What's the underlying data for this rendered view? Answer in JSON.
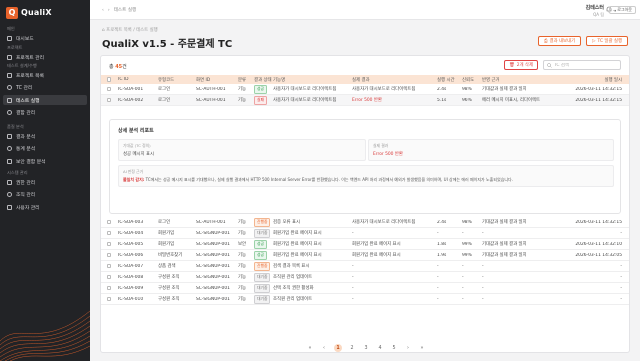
{
  "app": {
    "name": "QualiX",
    "logo_letter": "Q"
  },
  "sidebar": {
    "sections": [
      {
        "title": "메인",
        "items": [
          {
            "label": "대시보드",
            "icon": "grid-icon"
          }
        ]
      },
      {
        "title": "프로젝트",
        "items": [
          {
            "label": "프로젝트 관리",
            "icon": "folder-icon"
          }
        ]
      },
      {
        "title": "테스트 설계/수행",
        "items": [
          {
            "label": "프로젝트 목록",
            "icon": "list-icon"
          },
          {
            "label": "TC 관리",
            "icon": "doc-icon"
          },
          {
            "label": "테스트 실행",
            "icon": "play-icon",
            "active": true
          },
          {
            "label": "결함 관리",
            "icon": "bug-icon"
          }
        ]
      },
      {
        "title": "품질 분석",
        "items": [
          {
            "label": "결과 분석",
            "icon": "chart-icon"
          },
          {
            "label": "통계 분석",
            "icon": "stats-icon"
          },
          {
            "label": "보안 결함 분석",
            "icon": "shield-icon"
          }
        ]
      },
      {
        "title": "시스템 관리",
        "items": [
          {
            "label": "권한 관리",
            "icon": "key-icon"
          },
          {
            "label": "조직 관리",
            "icon": "org-icon"
          },
          {
            "label": "사용자 관리",
            "icon": "user-icon"
          }
        ]
      }
    ]
  },
  "topbar": {
    "breadcrumb": "테스트 실행",
    "user_name": "김테스터",
    "user_role": "QA 팀",
    "logout": "로그아웃"
  },
  "page": {
    "breadcrumb": "⌂ 프로젝트 목록 / 테스트 실행",
    "title": "QualiX v1.5 - 주문결제 TC",
    "btn_report": "결과 내보내기",
    "btn_bulk": "TC 일괄 실행"
  },
  "toolbar": {
    "count_prefix": "총 ",
    "count": "45",
    "count_suffix": "건",
    "delete_label": "2개 삭제",
    "search_placeholder": "TC 검색"
  },
  "table": {
    "headers": [
      "TC ID",
      "유형코드",
      "화면 ID",
      "분류",
      "결과 상태",
      "기능명",
      "실제 결과",
      "실행 시간",
      "신뢰도",
      "반영 근거",
      "실행 일시"
    ],
    "rows": [
      {
        "id": "TC-SOA-001",
        "type": "로그인",
        "screen": "SC-AUTH-001",
        "cls": "기능",
        "status": "성공",
        "status_kind": "pass",
        "feature": "사용자가 대시보드로 리다이렉트됨",
        "result": "사용자가 대시보드로 리다이렉트됨",
        "time": "2.4s",
        "conf": "98%",
        "basis": "기대값과 실제 결과 일치",
        "date": "2026-03-11 14:32:15",
        "sel": false
      },
      {
        "id": "TC-SOA-002",
        "type": "로그인",
        "screen": "SC-AUTH-001",
        "cls": "기능",
        "status": "실패",
        "status_kind": "fail",
        "feature": "사용자가 대시보드로 리다이렉트됨",
        "result": "Error 500 반환",
        "time": "5.1s",
        "conf": "96%",
        "basis": "에러 메시지 미표시, 리다이렉트",
        "date": "2026-03-11 14:32:15",
        "sel": true,
        "result_red": true
      },
      {
        "id": "TC-SOA-003",
        "type": "로그인",
        "screen": "SC-AUTH-001",
        "cls": "기능",
        "status": "진행중",
        "status_kind": "run",
        "feature": "검증 오류 표시",
        "result": "사용자가 대시보드로 리다이렉트됨",
        "time": "2.4s",
        "conf": "98%",
        "basis": "기대값과 실제 결과 일치",
        "date": "2026-03-11 14:32:15",
        "sel": false
      },
      {
        "id": "TC-SOA-004",
        "type": "회원가입",
        "screen": "SC-SIGNUP-001",
        "cls": "기능",
        "status": "대기중",
        "status_kind": "wait",
        "feature": "회원가입 완료 페이지 표시",
        "result": "-",
        "time": "-",
        "conf": "-",
        "basis": "-",
        "date": "-",
        "sel": false
      },
      {
        "id": "TC-SOA-005",
        "type": "회원가입",
        "screen": "SC-SIGNUP-001",
        "cls": "보안",
        "status": "성공",
        "status_kind": "pass",
        "feature": "회원가입 완료 페이지 표시",
        "result": "회원가입 완료 페이지 표시",
        "time": "1.8s",
        "conf": "99%",
        "basis": "기대값과 실제 결과 일치",
        "date": "2026-03-11 14:32:10",
        "sel": false
      },
      {
        "id": "TC-SOA-006",
        "type": "비밀번호찾기",
        "screen": "SC-SIGNUP-001",
        "cls": "기능",
        "status": "성공",
        "status_kind": "pass",
        "feature": "회원가입 완료 페이지 표시",
        "result": "회원가입 완료 페이지 표시",
        "time": "1.9s",
        "conf": "99%",
        "basis": "기대값과 실제 결과 일치",
        "date": "2026-03-11 14:32:05",
        "sel": false
      },
      {
        "id": "TC-SOA-007",
        "type": "상품 검색",
        "screen": "SC-SIGNUP-001",
        "cls": "기능",
        "status": "진행중",
        "status_kind": "run",
        "feature": "검색 결과 목록 표시",
        "result": "-",
        "time": "-",
        "conf": "-",
        "basis": "-",
        "date": "-",
        "sel": false
      },
      {
        "id": "TC-SOA-008",
        "type": "구성원 조직",
        "screen": "SC-SIGNUP-001",
        "cls": "기능",
        "status": "대기중",
        "status_kind": "wait",
        "feature": "조직원 관리 업데이트",
        "result": "-",
        "time": "-",
        "conf": "-",
        "basis": "-",
        "date": "-",
        "sel": false
      },
      {
        "id": "TC-SOA-009",
        "type": "구성원 조직",
        "screen": "SC-SIGNUP-001",
        "cls": "기능",
        "status": "대기중",
        "status_kind": "wait",
        "feature": "선택 조직 권한 활성화",
        "result": "-",
        "time": "-",
        "conf": "-",
        "basis": "-",
        "date": "-",
        "sel": false
      },
      {
        "id": "TC-SOA-010",
        "type": "구성원 조직",
        "screen": "SC-SIGNUP-001",
        "cls": "기능",
        "status": "대기중",
        "status_kind": "wait",
        "feature": "조직원 관리 업데이트",
        "result": "-",
        "time": "-",
        "conf": "-",
        "basis": "-",
        "date": "-",
        "sel": false
      }
    ]
  },
  "detail": {
    "title": "상세 분석 리포트",
    "expected_label": "기대값 (TC 정의)",
    "expected_value": "성공 메시지 표시",
    "actual_label": "실제 결과",
    "actual_value": "Error 500 반환",
    "ai_label": "AI 판정 근거",
    "ai_highlight": "불일치 감지:",
    "ai_text": " TC에서는 성공 메시지 표시를 기대했으나, 실제 실행 결과에서 HTTP 500 Internal Server Error를 반환했습니다. 이는 백엔드 API 처리 과정에서 예외가 발생했음을 의미하며, UI 상에는 에러 페이지가 노출되었습니다."
  },
  "pagination": {
    "pages": [
      "1",
      "2",
      "3",
      "4",
      "5"
    ],
    "current": "1",
    "first": "«",
    "prev": "‹",
    "next": "›",
    "last": "»"
  },
  "colors": {
    "accent": "#e8632b",
    "sidebar_bg": "#222326",
    "header_row": "#fbe4d4"
  }
}
